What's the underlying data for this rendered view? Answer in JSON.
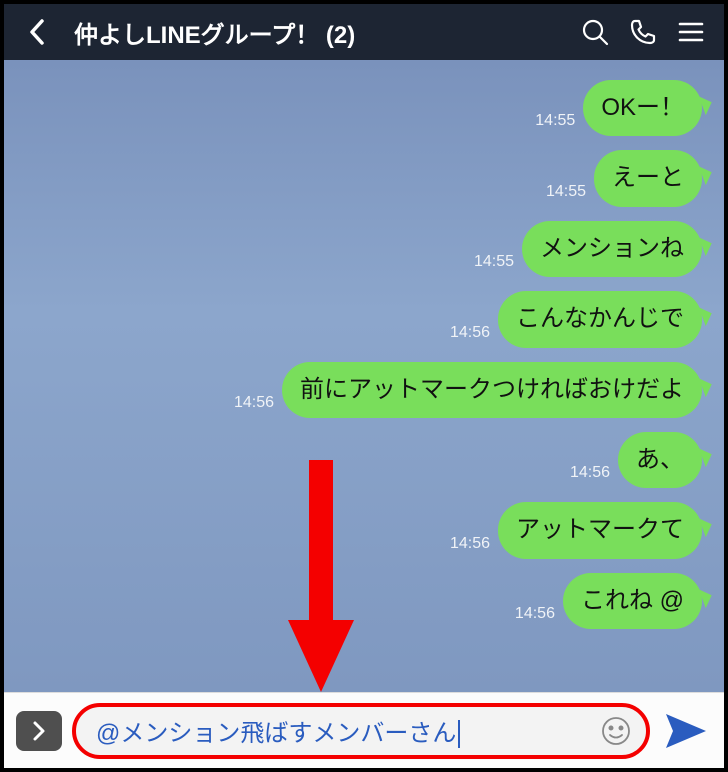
{
  "header": {
    "title": "仲よしLINEグループ！ (2)"
  },
  "messages": [
    {
      "time": "14:55",
      "text": "OKー！"
    },
    {
      "time": "14:55",
      "text": "えーと"
    },
    {
      "time": "14:55",
      "text": "メンションね"
    },
    {
      "time": "14:56",
      "text": "こんなかんじで"
    },
    {
      "time": "14:56",
      "text": "前にアットマークつければおけだよ"
    },
    {
      "time": "14:56",
      "text": "あ、"
    },
    {
      "time": "14:56",
      "text": "アットマークて"
    },
    {
      "time": "14:56",
      "text": "これね @"
    }
  ],
  "composer": {
    "input_text": "@メンション飛ばすメンバーさん"
  },
  "colors": {
    "bubble": "#79de5b",
    "header_bg": "#1d2533",
    "highlight_border": "#f40000",
    "mention": "#2a5cbf"
  }
}
